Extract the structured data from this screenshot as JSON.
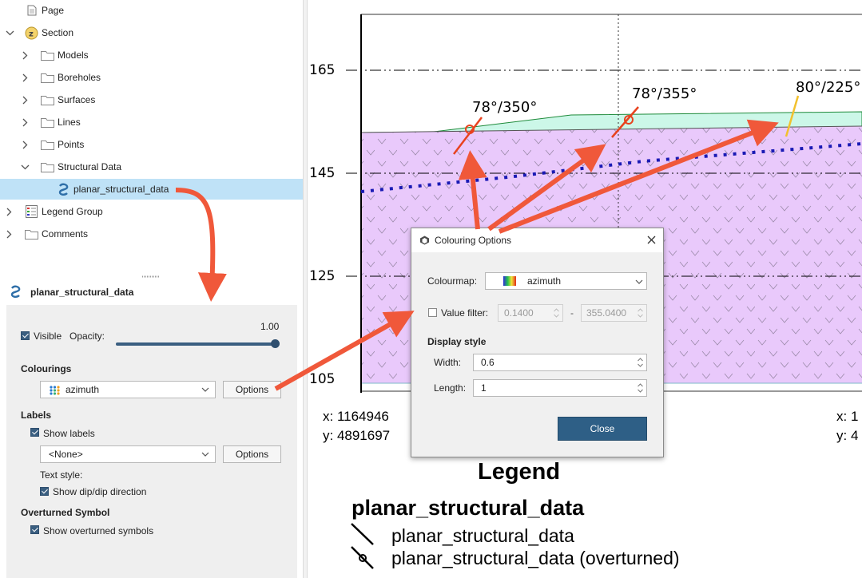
{
  "tree": {
    "items": [
      {
        "label": "Page",
        "icon": "page-icon"
      },
      {
        "label": "Section",
        "icon": "section-icon"
      },
      {
        "label": "Models",
        "icon": "folder-icon"
      },
      {
        "label": "Boreholes",
        "icon": "folder-icon"
      },
      {
        "label": "Surfaces",
        "icon": "folder-icon"
      },
      {
        "label": "Lines",
        "icon": "folder-icon"
      },
      {
        "label": "Points",
        "icon": "folder-icon"
      },
      {
        "label": "Structural Data",
        "icon": "folder-icon"
      },
      {
        "label": "planar_structural_data",
        "icon": "planar-data-icon",
        "selected": true
      },
      {
        "label": "Legend Group",
        "icon": "legend-group-icon"
      },
      {
        "label": "Comments",
        "icon": "folder-icon"
      }
    ]
  },
  "properties": {
    "title": "planar_structural_data",
    "visible_label": "Visible",
    "visible_checked": true,
    "opacity_label": "Opacity:",
    "opacity_value": "1.00",
    "opacity_fraction": 1.0,
    "colourings_heading": "Colourings",
    "colouring_value": "azimuth",
    "options_label": "Options",
    "labels_heading": "Labels",
    "show_labels": "Show labels",
    "label_value": "<None>",
    "text_style_label": "Text style:",
    "show_dip": "Show dip/dip direction",
    "overturned_heading": "Overturned Symbol",
    "show_overturned": "Show overturned symbols"
  },
  "section_view": {
    "elevations": [
      "165",
      "145",
      "125",
      "105"
    ],
    "measurements": [
      "78°/350°",
      "78°/355°",
      "80°/225°"
    ],
    "coord_left_x": "x: 1164946",
    "coord_left_y": "y: 4891697",
    "coord_right_x": "x: 1",
    "coord_right_y": "y: 4",
    "colors": {
      "upper_layer": "#ccf7e8",
      "lower_layer": "#e9c9fb",
      "symbol_red": "#e8421e",
      "symbol_yellow": "#f2c12e",
      "trace": "#1a1ab5"
    }
  },
  "dialog": {
    "title": "Colouring Options",
    "colourmap_label": "Colourmap:",
    "colourmap_value": "azimuth",
    "value_filter_label": "Value filter:",
    "value_filter_checked": false,
    "filter_min": "0.1400",
    "filter_dash": "-",
    "filter_max": "355.0400",
    "display_style_heading": "Display style",
    "width_label": "Width:",
    "width_value": "0.6",
    "length_label": "Length:",
    "length_value": "1",
    "close_label": "Close"
  },
  "legend": {
    "title": "Legend",
    "subtitle": "planar_structural_data",
    "items": [
      "planar_structural_data",
      "planar_structural_data (overturned)"
    ]
  }
}
